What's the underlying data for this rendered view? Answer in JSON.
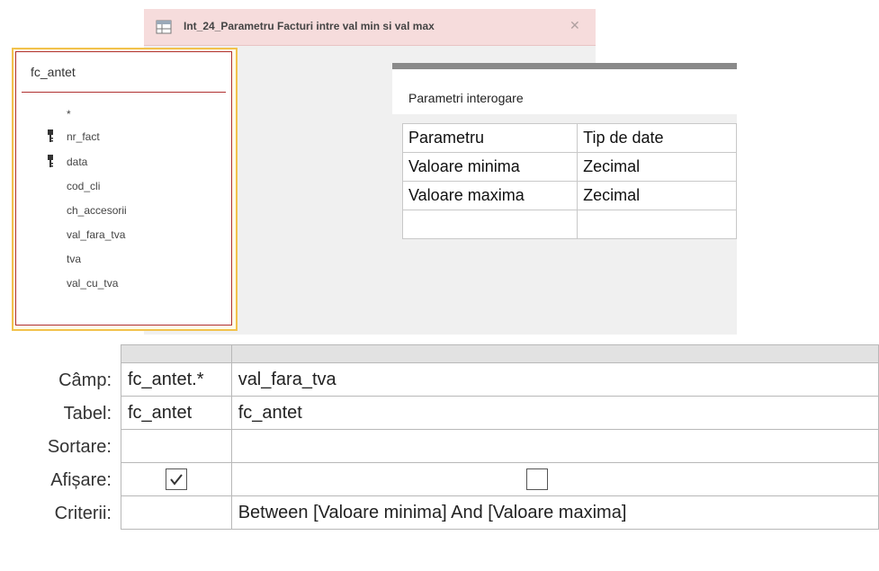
{
  "window": {
    "title": "Int_24_Parametru Facturi intre val min si val max",
    "close_glyph": "✕"
  },
  "table_box": {
    "title": "fc_antet",
    "fields": [
      {
        "name": "*",
        "key": false
      },
      {
        "name": "nr_fact",
        "key": true
      },
      {
        "name": "data",
        "key": true
      },
      {
        "name": "cod_cli",
        "key": false
      },
      {
        "name": "ch_accesorii",
        "key": false
      },
      {
        "name": "val_fara_tva",
        "key": false
      },
      {
        "name": "tva",
        "key": false
      },
      {
        "name": "val_cu_tva",
        "key": false
      }
    ]
  },
  "param_dialog": {
    "title": "Parametri interogare",
    "headers": [
      "Parametru",
      "Tip de date"
    ],
    "rows": [
      [
        "Valoare minima",
        "Zecimal"
      ],
      [
        "Valoare maxima",
        "Zecimal"
      ],
      [
        "",
        ""
      ]
    ]
  },
  "qbe": {
    "row_labels": {
      "camp": "Câmp:",
      "tabel": "Tabel:",
      "sortare": "Sortare:",
      "afisare": "Afișare:",
      "criterii": "Criterii:"
    },
    "columns": [
      {
        "camp": "fc_antet.*",
        "tabel": "fc_antet",
        "sortare": "",
        "afisare": true,
        "criterii": ""
      },
      {
        "camp": "val_fara_tva",
        "tabel": "fc_antet",
        "sortare": "",
        "afisare": false,
        "criterii": "Between [Valoare minima] And [Valoare maxima]"
      }
    ]
  },
  "colors": {
    "tab_background": "#f6dcdc",
    "table_border_highlight": "#f2c24c",
    "table_inner_border": "#b03030"
  },
  "icons": {
    "query_icon": "query-icon",
    "key_icon": "primary-key-icon",
    "checkmark": "checkmark-icon"
  }
}
